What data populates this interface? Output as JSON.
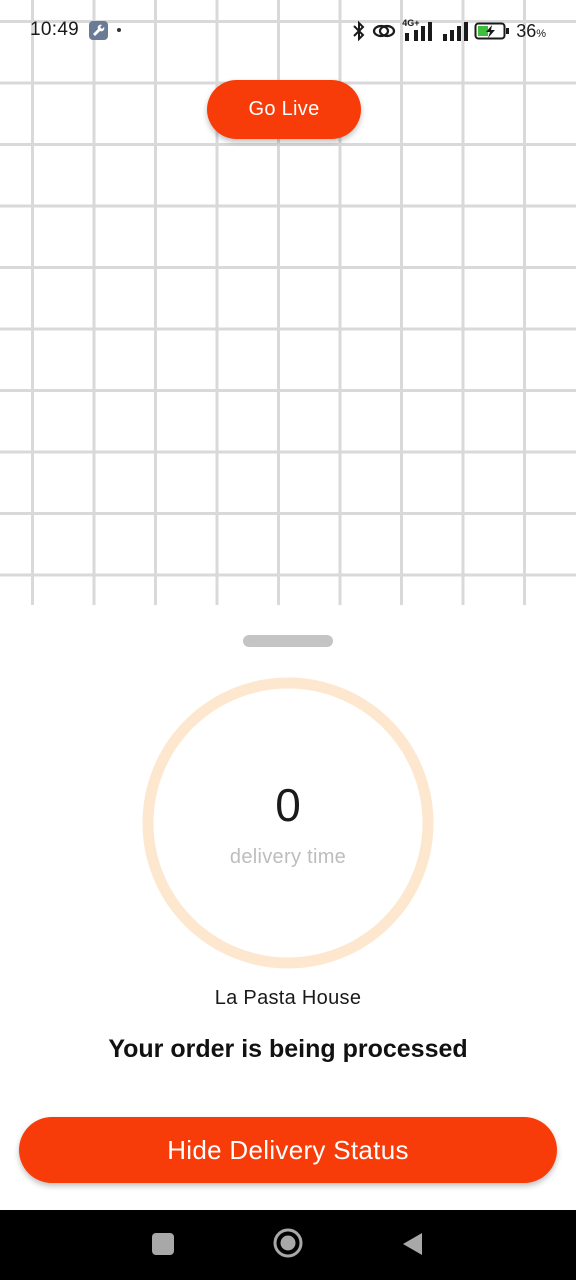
{
  "status_bar": {
    "time": "10:49",
    "battery_percent": "36",
    "battery_unit": "%",
    "network_label": "4G+",
    "icons": [
      "wrench-icon",
      "bluetooth-icon",
      "link-icon",
      "signal-4g-icon",
      "signal-icon",
      "battery-charging-icon"
    ]
  },
  "map": {
    "go_live_label": "Go Live"
  },
  "delivery": {
    "time_value": "0",
    "time_label": "delivery time",
    "progress": 0,
    "restaurant": "La Pasta House",
    "status_message": "Your order is being processed",
    "hide_button_label": "Hide Delivery Status"
  },
  "nav_bar": {
    "icons": [
      "recents-icon",
      "home-icon",
      "back-icon"
    ]
  },
  "colors": {
    "accent": "#f73c0a",
    "ring_track": "#fde7cf",
    "grid_line": "#d9d9d9"
  }
}
